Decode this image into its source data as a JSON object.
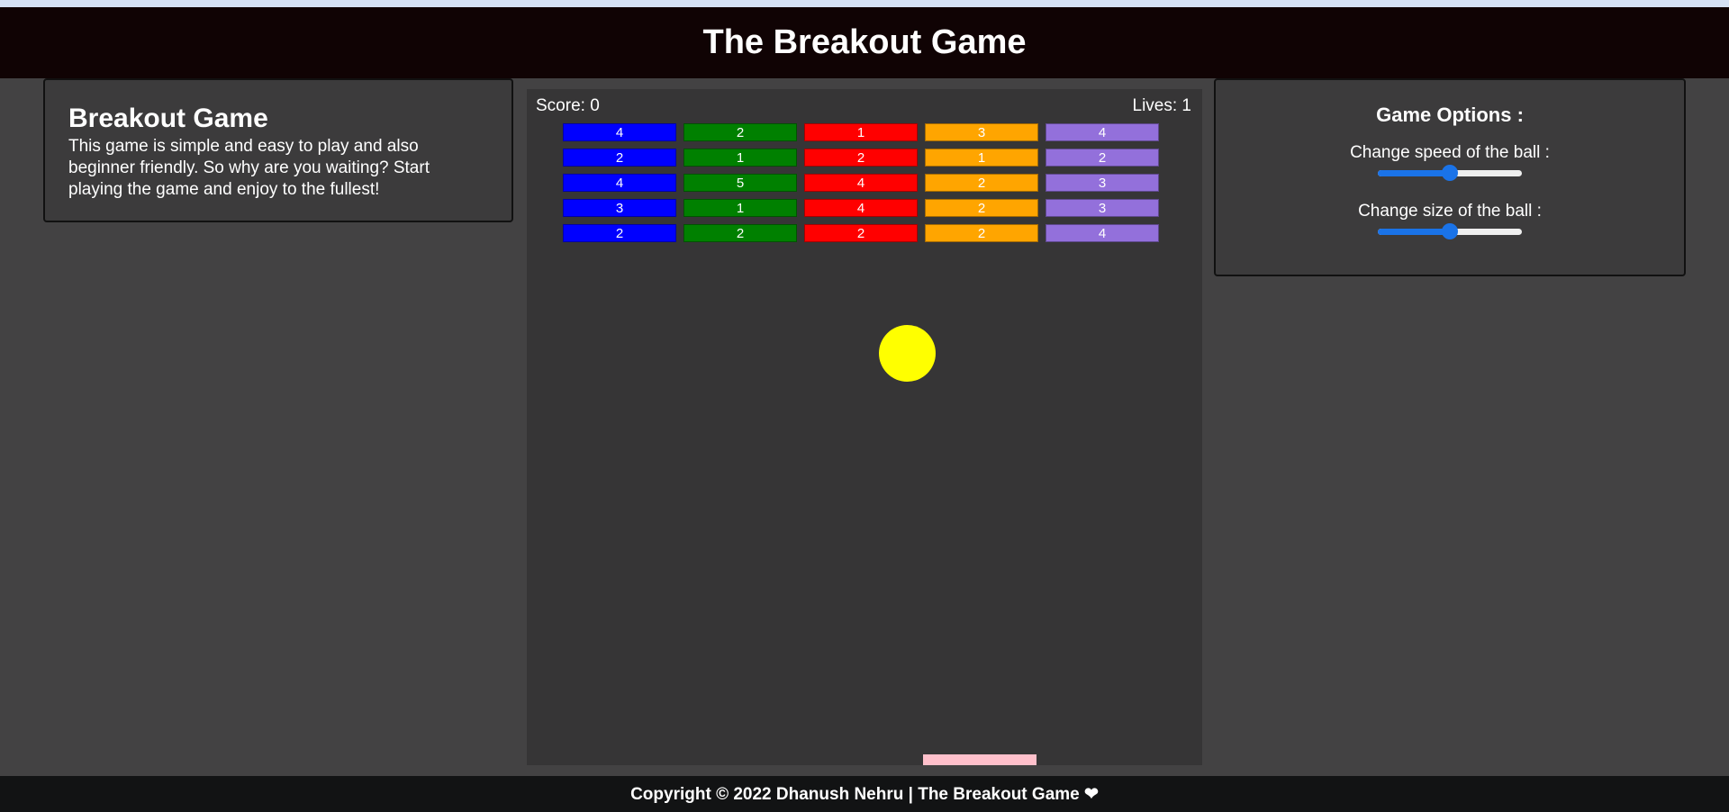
{
  "header": {
    "title": "The Breakout Game"
  },
  "info": {
    "title": "Breakout Game",
    "description": "This game is simple and easy to play and also beginner friendly. So why are you waiting? Start playing the game and enjoy to the fullest!"
  },
  "game": {
    "score_text": "Score: 0",
    "lives_text": "Lives: 1",
    "brick_colors": [
      "#0000ff",
      "#008000",
      "#ff0000",
      "#ffa500",
      "#9370db"
    ],
    "brick_rows": [
      [
        "4",
        "2",
        "1",
        "3",
        "4"
      ],
      [
        "2",
        "1",
        "2",
        "1",
        "2"
      ],
      [
        "4",
        "5",
        "4",
        "2",
        "3"
      ],
      [
        "3",
        "1",
        "4",
        "2",
        "3"
      ],
      [
        "2",
        "2",
        "2",
        "2",
        "4"
      ]
    ],
    "ball_color": "#ffff00",
    "paddle_color": "#ffc0cb"
  },
  "options": {
    "title": "Game Options :",
    "speed_label": "Change speed of the ball :",
    "speed_value": 0.5,
    "size_label": "Change size of the ball :",
    "size_value": 0.5
  },
  "footer": {
    "text": "Copyright © 2022 Dhanush Nehru | The Breakout Game ❤"
  }
}
